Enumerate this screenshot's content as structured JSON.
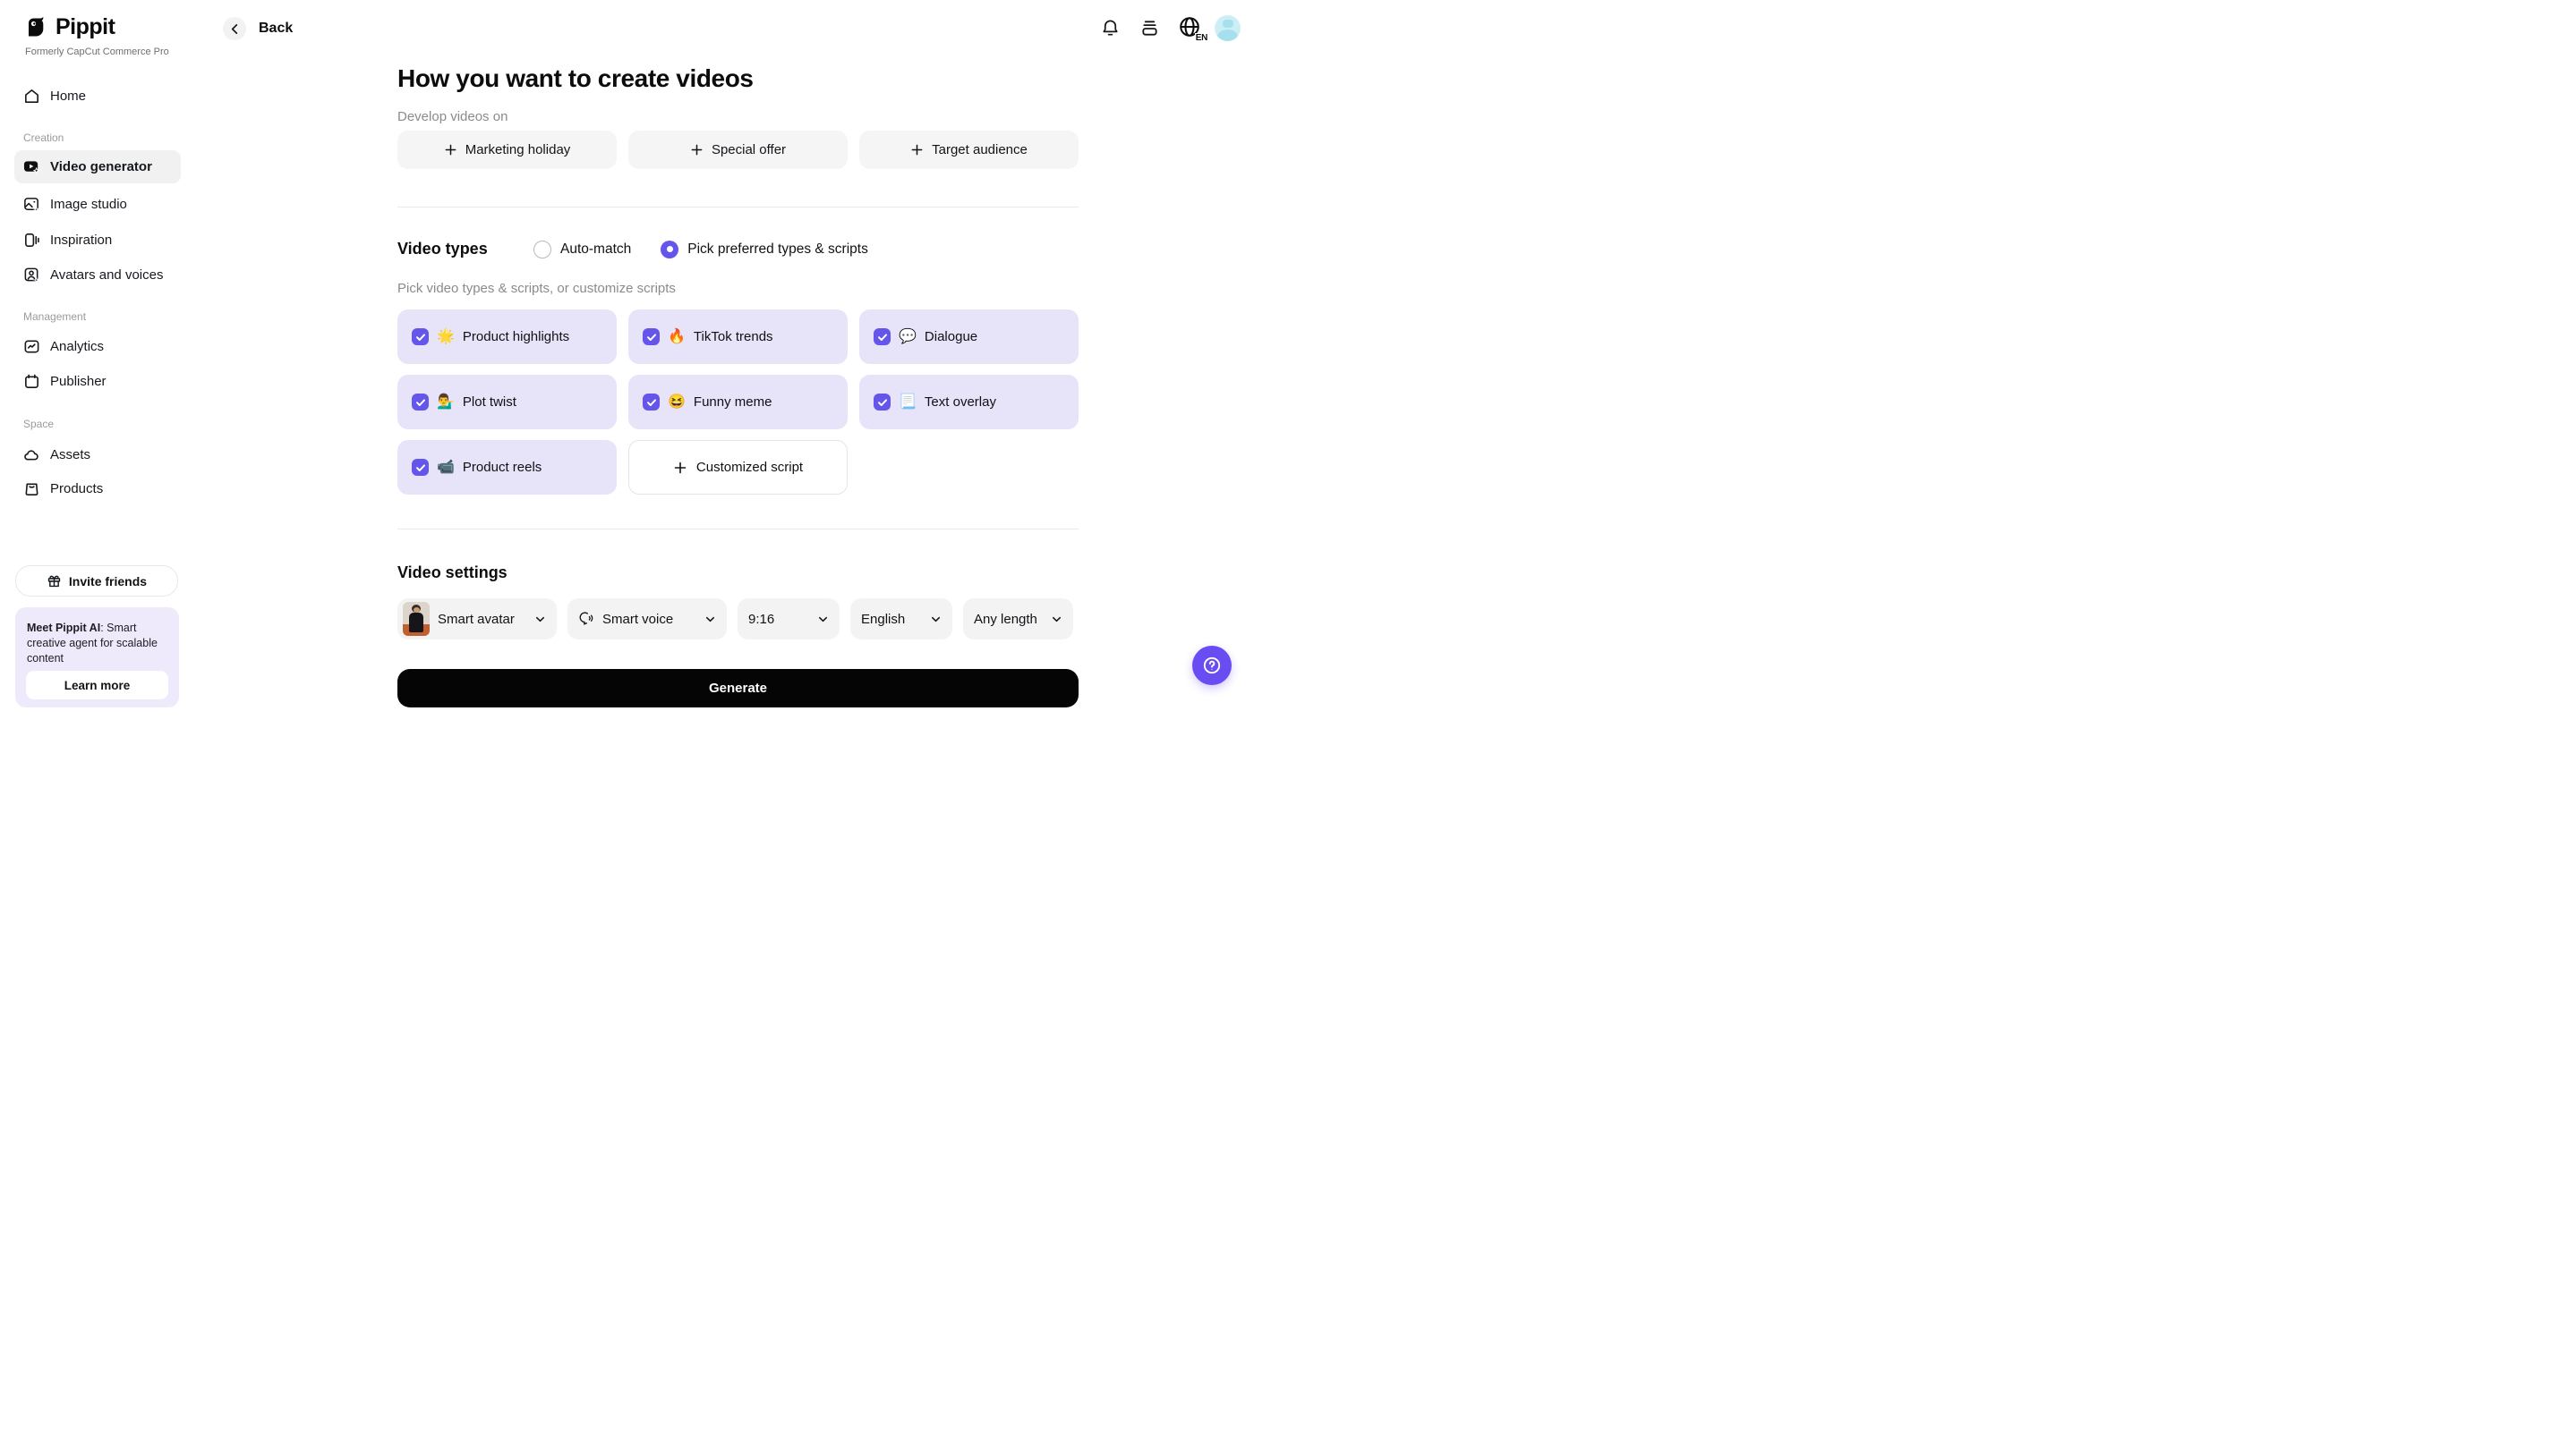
{
  "colors": {
    "accent_purple": "#6456EA",
    "fab_purple": "#6A4DF2",
    "option_card_bg": "#E7E3F9",
    "promo_bg": "#EFE9FC",
    "neutral_button_bg": "#F5F5F6",
    "active_nav_bg": "#F1F1F2",
    "generate_bg": "#050506",
    "avatar_badge_bg": "#CDEEF5",
    "avatar_badge_fg": "#A6E0EC"
  },
  "sidebar": {
    "logo": "Pippit",
    "tagline": "Formerly CapCut Commerce Pro",
    "home": "Home",
    "sections": [
      {
        "label": "Creation",
        "items": [
          {
            "label": "Video generator",
            "active": true
          },
          {
            "label": "Image studio",
            "active": false
          },
          {
            "label": "Inspiration",
            "active": false
          },
          {
            "label": "Avatars and voices",
            "active": false
          }
        ]
      },
      {
        "label": "Management",
        "items": [
          {
            "label": "Analytics",
            "active": false
          },
          {
            "label": "Publisher",
            "active": false
          }
        ]
      },
      {
        "label": "Space",
        "items": [
          {
            "label": "Assets",
            "active": false
          },
          {
            "label": "Products",
            "active": false
          }
        ]
      }
    ],
    "invite": "Invite friends",
    "promo": {
      "bold": "Meet Pippit AI",
      "rest": ": Smart creative agent for scalable content",
      "cta": "Learn more"
    }
  },
  "topbar": {
    "back": "Back",
    "language": "EN"
  },
  "main": {
    "title": "How you want to create videos",
    "develop_label": "Develop videos on",
    "develop_options": [
      "Marketing holiday",
      "Special offer",
      "Target audience"
    ],
    "video_types": {
      "label": "Video types",
      "radio_automatch": "Auto-match",
      "radio_pick": "Pick preferred types & scripts",
      "hint": "Pick video types & scripts, or customize scripts",
      "options": [
        {
          "emoji": "🌟",
          "label": "Product highlights",
          "checked": true
        },
        {
          "emoji": "🔥",
          "label": "TikTok trends",
          "checked": true
        },
        {
          "emoji": "💬",
          "label": "Dialogue",
          "checked": true
        },
        {
          "emoji": "💁‍♂️",
          "label": "Plot twist",
          "checked": true
        },
        {
          "emoji": "😆",
          "label": "Funny meme",
          "checked": true
        },
        {
          "emoji": "📃",
          "label": "Text overlay",
          "checked": true
        },
        {
          "emoji": "📹",
          "label": "Product reels",
          "checked": true
        }
      ],
      "custom_label": "Customized script"
    },
    "settings": {
      "label": "Video settings",
      "avatar": "Smart avatar",
      "voice": "Smart voice",
      "ratio": "9:16",
      "language": "English",
      "length": "Any length"
    },
    "generate": "Generate"
  }
}
